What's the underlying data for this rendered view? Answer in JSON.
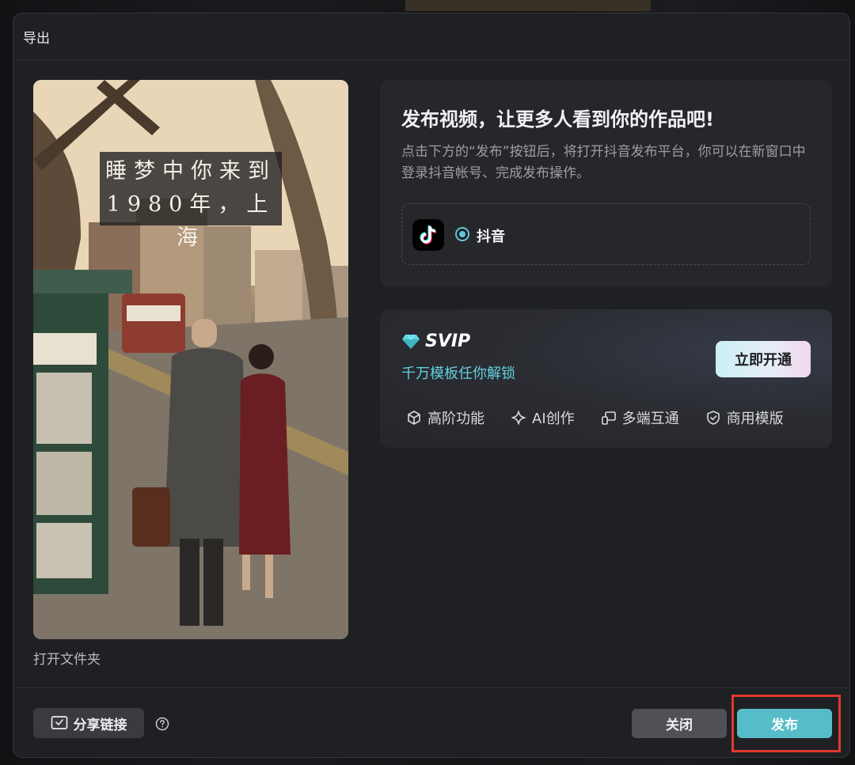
{
  "dialog": {
    "title": "导出"
  },
  "preview": {
    "caption_line1": "睡梦中你来到",
    "caption_line2": "1980年，上海",
    "open_folder": "打开文件夹"
  },
  "publish": {
    "headline": "发布视频，让更多人看到你的作品吧!",
    "description": "点击下方的“发布”按钮后，将打开抖音发布平台，你可以在新窗口中登录抖音帐号、完成发布操作。",
    "platform": {
      "icon": "tiktok-icon",
      "label": "抖音",
      "selected": true
    }
  },
  "svip": {
    "title": "SVIP",
    "subtitle": "千万模板任你解锁",
    "cta": "立即开通",
    "features": [
      {
        "icon": "cube-icon",
        "label": "高阶功能"
      },
      {
        "icon": "sparkle-icon",
        "label": "AI创作"
      },
      {
        "icon": "multi-device-icon",
        "label": "多端互通"
      },
      {
        "icon": "shield-check-icon",
        "label": "商用模版"
      }
    ]
  },
  "footer": {
    "share_label": "分享链接",
    "help_icon": "question-circle-icon",
    "close_label": "关闭",
    "publish_label": "发布"
  },
  "colors": {
    "accent": "#56bcc8",
    "svip_text": "#62d0de",
    "highlight": "#e0392b",
    "dialog_bg": "#1f2023"
  }
}
